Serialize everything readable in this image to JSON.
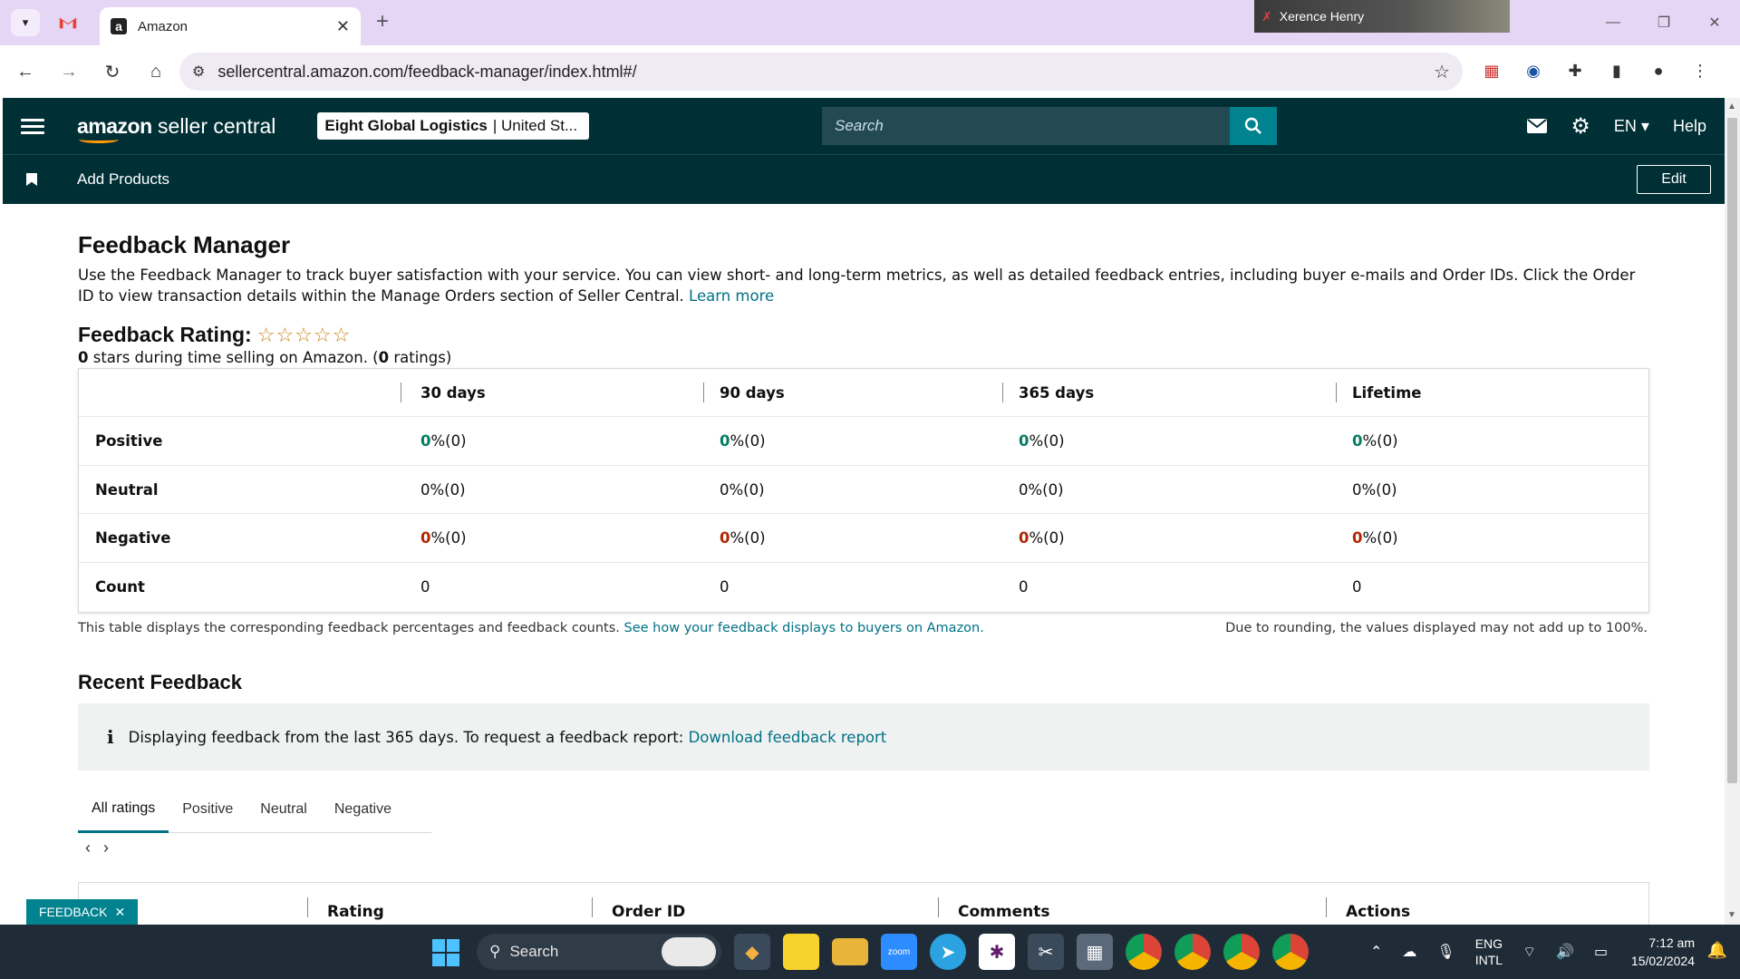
{
  "browser": {
    "tab_title": "Amazon",
    "tab_favicon": "a",
    "new_tab": "+",
    "url": "sellercentral.amazon.com/feedback-manager/index.html#/",
    "video_participant": "Xerence Henry"
  },
  "header": {
    "logo_main": "amazon",
    "logo_sub": " seller central",
    "account_name": "Eight Global Logistics",
    "account_region": "| United St...",
    "search_placeholder": "Search",
    "language": "EN",
    "help": "Help",
    "bookmark": "Add Products",
    "edit": "Edit"
  },
  "page": {
    "title": "Feedback Manager",
    "intro": "Use the Feedback Manager to track buyer satisfaction with your service. You can view short- and long-term metrics, as well as detailed feedback entries, including buyer e-mails and Order IDs. Click the Order ID to view transaction details within the Manage Orders section of Seller Central.",
    "learn_more": "Learn more",
    "rating_label": "Feedback Rating:",
    "stars": "☆☆☆☆☆",
    "rating_stars_count": "0",
    "rating_sub_a": " stars during time selling on Amazon. (",
    "rating_count": "0",
    "rating_sub_b": " ratings)"
  },
  "metrics": {
    "columns": [
      "30 days",
      "90 days",
      "365 days",
      "Lifetime"
    ],
    "rows": [
      {
        "label": "Positive",
        "cells": [
          [
            "0",
            " %(0)"
          ],
          [
            "0",
            " %(0)"
          ],
          [
            "0",
            " %(0)"
          ],
          [
            "0",
            " %(0)"
          ]
        ]
      },
      {
        "label": "Neutral",
        "cells": [
          [
            "0",
            " %(0)"
          ],
          [
            "0",
            " %(0)"
          ],
          [
            "0",
            " %(0)"
          ],
          [
            "0",
            " %(0)"
          ]
        ]
      },
      {
        "label": "Negative",
        "cells": [
          [
            "0",
            " %(0)"
          ],
          [
            "0",
            " %(0)"
          ],
          [
            "0",
            " %(0)"
          ],
          [
            "0",
            " %(0)"
          ]
        ]
      },
      {
        "label": "Count",
        "cells": [
          [
            "0",
            ""
          ],
          [
            "0",
            ""
          ],
          [
            "0",
            ""
          ],
          [
            "0",
            ""
          ]
        ]
      }
    ],
    "note": "This table displays the corresponding feedback percentages and feedback counts.",
    "note_link": "See how your feedback displays to buyers on Amazon.",
    "note_right": "Due to rounding, the values displayed may not add up to 100%."
  },
  "recent": {
    "title": "Recent Feedback",
    "info": "Displaying feedback from the last 365 days. To request a feedback report:",
    "info_link": "Download feedback report",
    "tabs": [
      "All ratings",
      "Positive",
      "Neutral",
      "Negative"
    ],
    "prev": "‹",
    "next": "›",
    "columns": [
      "Rating",
      "Order ID",
      "Comments",
      "Actions"
    ]
  },
  "feedback_tab": "FEEDBACK",
  "taskbar": {
    "search": "Search",
    "lang_line1": "ENG",
    "lang_line2": "INTL",
    "time": "7:12 am",
    "date": "15/02/2024"
  },
  "colors": {
    "header_bg": "#002f36",
    "link": "#007185",
    "positive": "#067d62",
    "negative": "#b12704",
    "star": "#c7841a"
  }
}
